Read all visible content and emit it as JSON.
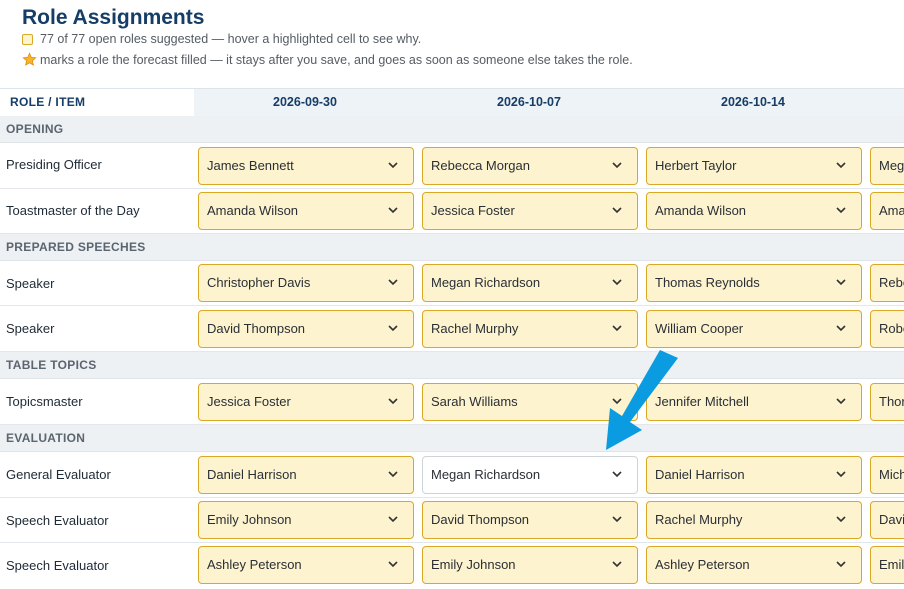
{
  "title": "Role Assignments",
  "summary": "77 of 77 open roles suggested — hover a highlighted cell to see why.",
  "legend": "marks a role the forecast filled — it stays after you save, and goes as soon as someone else takes the role.",
  "column_header": "ROLE / ITEM",
  "dates": [
    "2026-09-30",
    "2026-10-07",
    "2026-10-14"
  ],
  "sections": [
    {
      "name": "OPENING",
      "rows": [
        {
          "role": "Presiding Officer",
          "cells": [
            "James Bennett",
            "Rebecca Morgan",
            "Herbert Taylor",
            "Meg"
          ]
        },
        {
          "role": "Toastmaster of the Day",
          "cells": [
            "Amanda Wilson",
            "Jessica Foster",
            "Amanda Wilson",
            "Ama"
          ]
        }
      ]
    },
    {
      "name": "PREPARED SPEECHES",
      "rows": [
        {
          "role": "Speaker",
          "cells": [
            "Christopher Davis",
            "Megan Richardson",
            "Thomas Reynolds",
            "Rebe"
          ]
        },
        {
          "role": "Speaker",
          "cells": [
            "David Thompson",
            "Rachel Murphy",
            "William Cooper",
            "Robe"
          ]
        }
      ]
    },
    {
      "name": "TABLE TOPICS",
      "rows": [
        {
          "role": "Topicsmaster",
          "cells": [
            "Jessica Foster",
            "Sarah Williams",
            "Jennifer Mitchell",
            "Thor"
          ]
        }
      ]
    },
    {
      "name": "EVALUATION",
      "rows": [
        {
          "role": "General Evaluator",
          "cells": [
            "Daniel Harrison",
            "Megan Richardson",
            "Daniel Harrison",
            "Mich"
          ]
        },
        {
          "role": "Speech Evaluator",
          "cells": [
            "Emily Johnson",
            "David Thompson",
            "Rachel Murphy",
            "Davi"
          ]
        },
        {
          "role": "Speech Evaluator",
          "cells": [
            "Ashley Peterson",
            "Emily Johnson",
            "Ashley Peterson",
            "Emil"
          ]
        }
      ]
    }
  ],
  "colors": {
    "accent": "#163d67",
    "suggested_fill": "#fdf3cf",
    "suggested_border": "#d9a926",
    "arrow": "#0b9be0"
  },
  "icons": {
    "legend_square": "suggested-square-icon",
    "legend_star": "star-icon",
    "dropdown": "chevron-down-icon",
    "pointer": "arrow-annotation-icon"
  }
}
